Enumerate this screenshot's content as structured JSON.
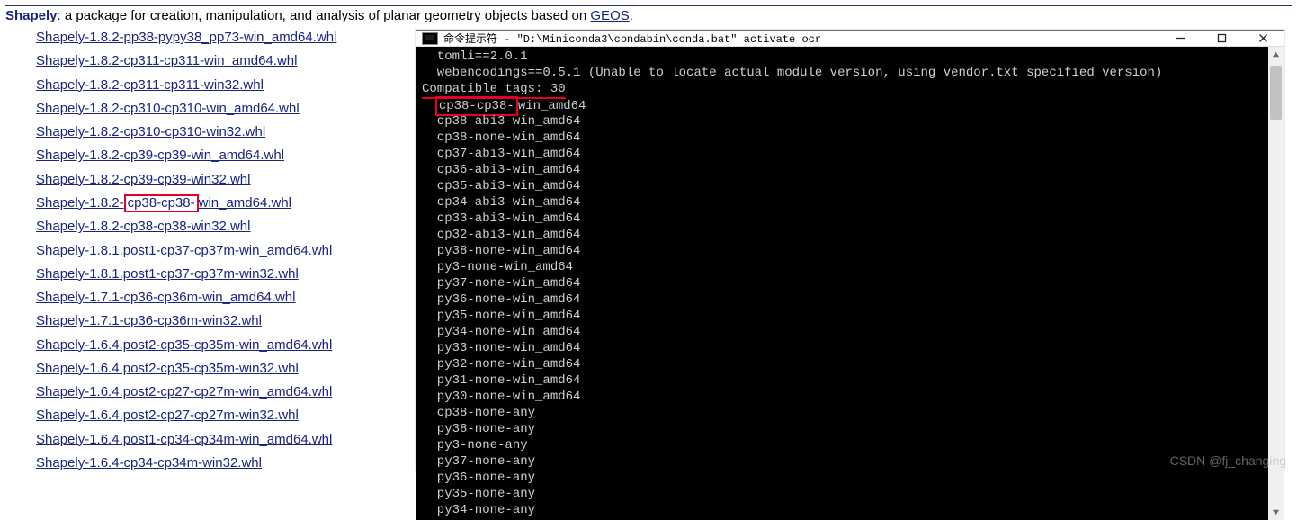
{
  "header": {
    "package_name": "Shapely",
    "desc_before": ": a package for creation, manipulation, and analysis of planar geometry objects based on ",
    "geos_label": "GEOS",
    "desc_after": "."
  },
  "files": [
    {
      "text": "Shapely-1.8.2-pp38-pypy38_pp73-win_amd64.whl"
    },
    {
      "text": "Shapely-1.8.2-cp311-cp311-win_amd64.whl"
    },
    {
      "text": "Shapely-1.8.2-cp311-cp311-win32.whl"
    },
    {
      "text": "Shapely-1.8.2-cp310-cp310-win_amd64.whl"
    },
    {
      "text": "Shapely-1.8.2-cp310-cp310-win32.whl"
    },
    {
      "text": "Shapely-1.8.2-cp39-cp39-win_amd64.whl"
    },
    {
      "text": "Shapely-1.8.2-cp39-cp39-win32.whl"
    },
    {
      "prefix": "Shapely-1.8.2-",
      "highlight": "cp38-cp38-",
      "suffix": "win_amd64.whl"
    },
    {
      "text": "Shapely-1.8.2-cp38-cp38-win32.whl"
    },
    {
      "text": "Shapely-1.8.1.post1-cp37-cp37m-win_amd64.whl"
    },
    {
      "text": "Shapely-1.8.1.post1-cp37-cp37m-win32.whl"
    },
    {
      "text": "Shapely-1.7.1-cp36-cp36m-win_amd64.whl"
    },
    {
      "text": "Shapely-1.7.1-cp36-cp36m-win32.whl"
    },
    {
      "text": "Shapely-1.6.4.post2-cp35-cp35m-win_amd64.whl"
    },
    {
      "text": "Shapely-1.6.4.post2-cp35-cp35m-win32.whl"
    },
    {
      "text": "Shapely-1.6.4.post2-cp27-cp27m-win_amd64.whl"
    },
    {
      "text": "Shapely-1.6.4.post2-cp27-cp27m-win32.whl"
    },
    {
      "text": "Shapely-1.6.4.post1-cp34-cp34m-win_amd64.whl"
    },
    {
      "text": "Shapely-1.6.4-cp34-cp34m-win32.whl"
    }
  ],
  "cmd": {
    "title": "命令提示符 - \"D:\\Miniconda3\\condabin\\conda.bat\"  activate ocr",
    "lines": [
      {
        "text": "  tomli==2.0.1"
      },
      {
        "text": "  webencodings==0.5.1 (Unable to locate actual module version, using vendor.txt specified version)"
      },
      {
        "text": "Compatible tags: 30",
        "underline_hl": true
      },
      {
        "prefix": "  ",
        "hl": "cp38-cp38-",
        "suffix": "win_amd64"
      },
      {
        "text": "  cp38-abi3-win_amd64"
      },
      {
        "text": "  cp38-none-win_amd64"
      },
      {
        "text": "  cp37-abi3-win_amd64"
      },
      {
        "text": "  cp36-abi3-win_amd64"
      },
      {
        "text": "  cp35-abi3-win_amd64"
      },
      {
        "text": "  cp34-abi3-win_amd64"
      },
      {
        "text": "  cp33-abi3-win_amd64"
      },
      {
        "text": "  cp32-abi3-win_amd64"
      },
      {
        "text": "  py38-none-win_amd64"
      },
      {
        "text": "  py3-none-win_amd64"
      },
      {
        "text": "  py37-none-win_amd64"
      },
      {
        "text": "  py36-none-win_amd64"
      },
      {
        "text": "  py35-none-win_amd64"
      },
      {
        "text": "  py34-none-win_amd64"
      },
      {
        "text": "  py33-none-win_amd64"
      },
      {
        "text": "  py32-none-win_amd64"
      },
      {
        "text": "  py31-none-win_amd64"
      },
      {
        "text": "  py30-none-win_amd64"
      },
      {
        "text": "  cp38-none-any"
      },
      {
        "text": "  py38-none-any"
      },
      {
        "text": "  py3-none-any"
      },
      {
        "text": "  py37-none-any"
      },
      {
        "text": "  py36-none-any"
      },
      {
        "text": "  py35-none-any"
      },
      {
        "text": "  py34-none-any"
      }
    ]
  },
  "watermark": "CSDN @fj_changing"
}
